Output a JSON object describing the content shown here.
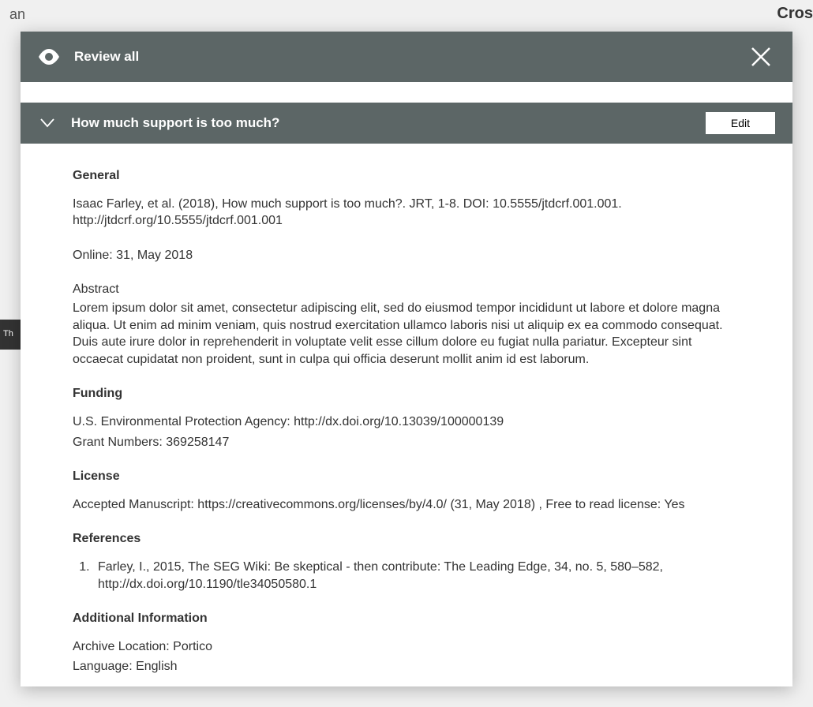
{
  "backdrop": {
    "leftFragment": "an",
    "rightFragment": "Cros",
    "sidebarStub": "Th"
  },
  "modal": {
    "title": "Review all",
    "subTitle": "How much support is too much?",
    "editLabel": "Edit"
  },
  "sections": {
    "general": {
      "heading": "General",
      "citation": "Isaac Farley, et al. (2018), How much support is too much?. JRT, 1-8. DOI: 10.5555/jtdcrf.001.001. http://jtdcrf.org/10.5555/jtdcrf.001.001",
      "online": "Online: 31, May 2018",
      "abstractLabel": "Abstract",
      "abstract": "Lorem ipsum dolor sit amet, consectetur adipiscing elit, sed do eiusmod tempor incididunt ut labore et dolore magna aliqua. Ut enim ad minim veniam, quis nostrud exercitation ullamco laboris nisi ut aliquip ex ea commodo consequat. Duis aute irure dolor in reprehenderit in voluptate velit esse cillum dolore eu fugiat nulla pariatur. Excepteur sint occaecat cupidatat non proident, sunt in culpa qui officia deserunt mollit anim id est laborum."
    },
    "funding": {
      "heading": "Funding",
      "agency": "U.S. Environmental Protection Agency: http://dx.doi.org/10.13039/100000139",
      "grant": "Grant Numbers: 369258147"
    },
    "license": {
      "heading": "License",
      "text": "Accepted Manuscript: https://creativecommons.org/licenses/by/4.0/ (31, May 2018) , Free to read license: Yes"
    },
    "references": {
      "heading": "References",
      "items": [
        "Farley, I., 2015, The SEG Wiki: Be skeptical - then contribute: The Leading Edge, 34, no. 5, 580–582, http://dx.doi.org/10.1190/tle34050580.1"
      ]
    },
    "additional": {
      "heading": "Additional Information",
      "archive": "Archive Location: Portico",
      "language": "Language: English"
    }
  }
}
